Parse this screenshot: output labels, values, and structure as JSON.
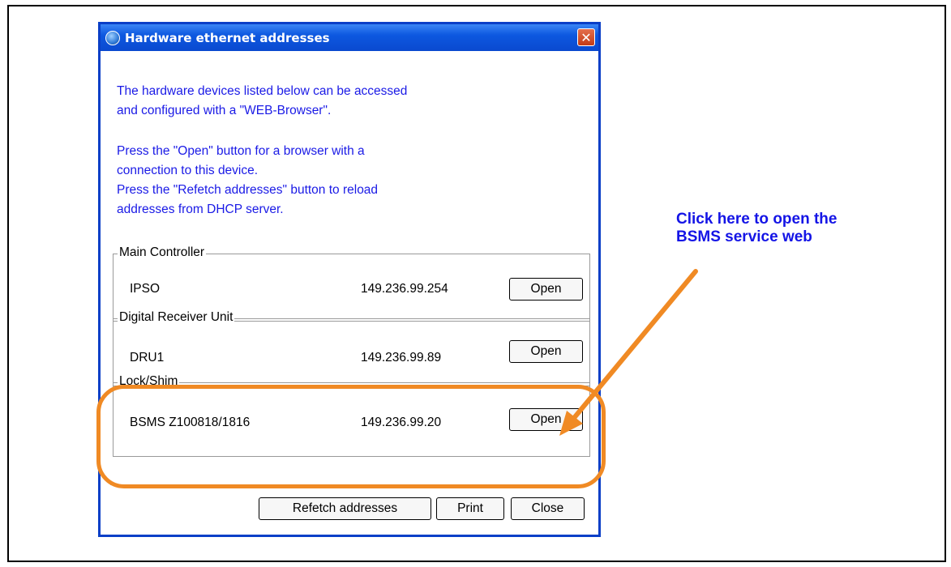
{
  "dialog": {
    "title": "Hardware ethernet addresses",
    "close_glyph": "✕",
    "intro_line1": "The hardware devices listed below can be accessed",
    "intro_line2": "and configured with a \"WEB-Browser\".",
    "intro_line3": "Press the \"Open\" button for a browser with a",
    "intro_line4": "connection to this device.",
    "intro_line5": "Press the \"Refetch addresses\" button to reload",
    "intro_line6": "addresses from DHCP server.",
    "groups": [
      {
        "legend": "Main Controller",
        "device": "IPSO",
        "ip": "149.236.99.254",
        "button": "Open"
      },
      {
        "legend": "Digital Receiver Unit",
        "device": "DRU1",
        "ip": "149.236.99.89",
        "button": "Open"
      },
      {
        "legend": "Lock/Shim",
        "device": "BSMS Z100818/1816",
        "ip": "149.236.99.20",
        "button": "Open"
      }
    ],
    "footer": {
      "refetch": "Refetch addresses",
      "print": "Print",
      "close": "Close"
    }
  },
  "annotation": {
    "callout_line1": "Click here to open the",
    "callout_line2": "BSMS service web",
    "highlight_color": "#f08a24",
    "text_color": "#1414e6"
  },
  "icons": {
    "app": "globe-icon",
    "close": "close-icon"
  }
}
